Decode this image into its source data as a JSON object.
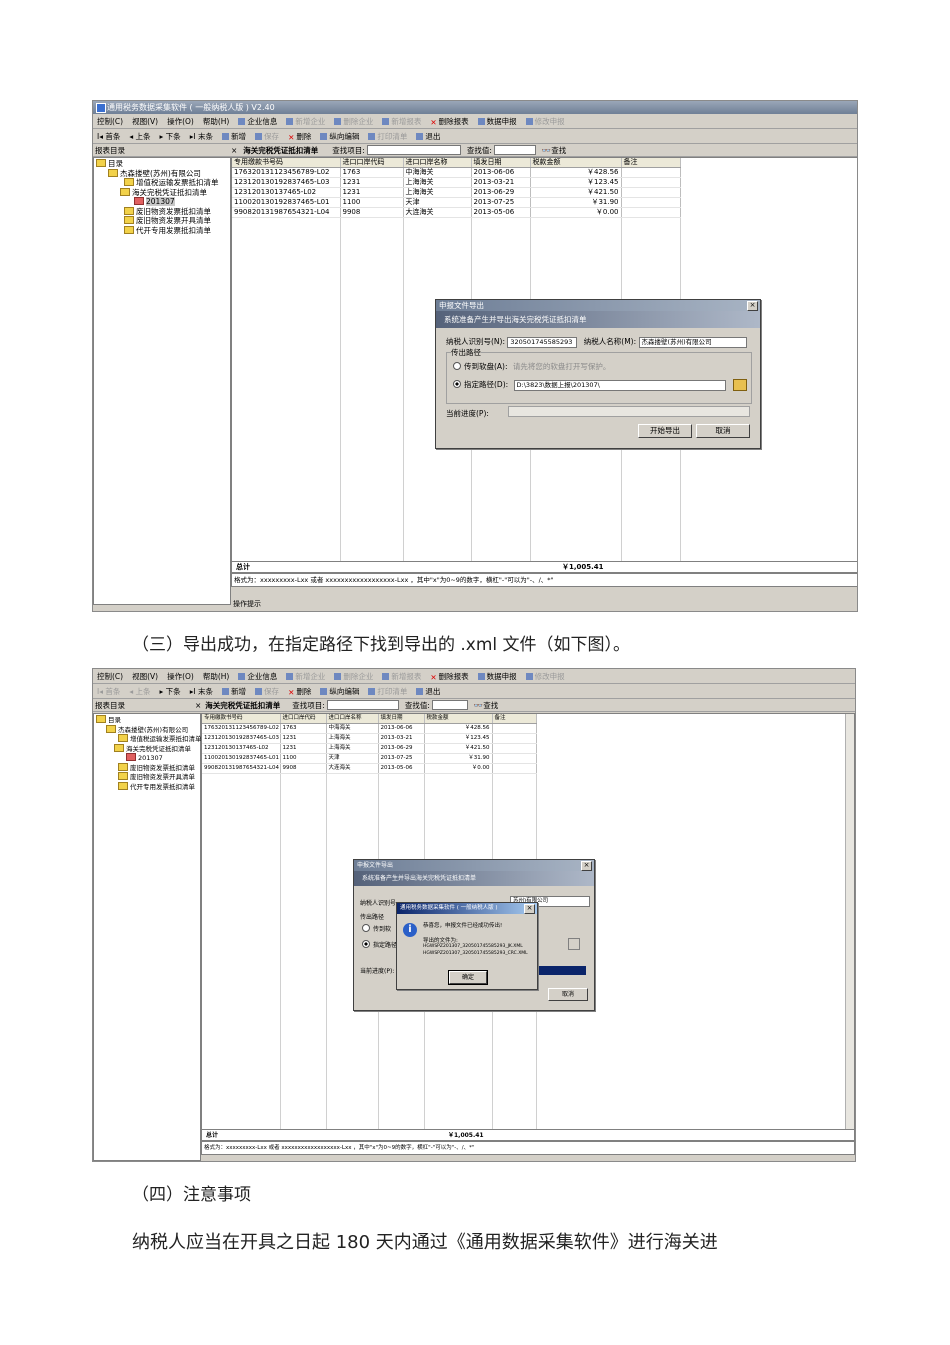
{
  "shot1": {
    "title": "通用税务数据采集软件 ( 一般纳税人版 ) V2.40",
    "menu": [
      "控制(C)",
      "视图(V)",
      "操作(O)",
      "帮助(H)"
    ],
    "toolbar": [
      "企业信息",
      "新增企业",
      "删除企业",
      "新增报表",
      "删除报表",
      "数据申报",
      "修改申报"
    ],
    "nav": [
      "I◂ 首条",
      "◂ 上条",
      "▸ 下条",
      "▸I 末条",
      "新增",
      "保存",
      "删除",
      "纵向编辑",
      "打印清单",
      "退出"
    ],
    "pane_label": "报表目录",
    "pane_close": "×",
    "grid_title": "海关完税凭证抵扣清单",
    "search_item_label": "查找项目:",
    "search_value_label": "查找值:",
    "search_button": "查找",
    "tree": [
      "目录",
      "杰森搂壁(苏州)有限公司",
      "增值税运输发票抵扣清单",
      "海关完税凭证抵扣清单",
      "201307",
      "废旧物资发票抵扣清单",
      "废旧物资发票开具清单",
      "代开专用发票抵扣清单"
    ],
    "columns": [
      "专用缴款书号码",
      "进口口岸代码",
      "进口口岸名称",
      "填发日期",
      "税款金额",
      "备注"
    ],
    "rows": [
      [
        "176320131123456789-L02",
        "1763",
        "中海海关",
        "2013-06-06",
        "￥428.56",
        ""
      ],
      [
        "123120130192837465-L03",
        "1231",
        "上海海关",
        "2013-03-21",
        "￥123.45",
        ""
      ],
      [
        "123120130137465-L02",
        "1231",
        "上海海关",
        "2013-06-29",
        "￥421.50",
        ""
      ],
      [
        "110020130192837465-L01",
        "1100",
        "天津",
        "2013-07-25",
        "￥31.90",
        ""
      ],
      [
        "990820131987654321-L04",
        "9908",
        "大连海关",
        "2013-05-06",
        "￥0.00",
        ""
      ]
    ],
    "total_label": "总计",
    "total_value": "￥1,005.41",
    "format_text": "格式为：xxxxxxxxx-Lxx 或者 xxxxxxxxxxxxxxxxxx-Lxx ，其中\"x\"为0~9的数字，横杠\"-\"可以为\"-、/、*\"",
    "status_label": "操作提示",
    "dialog": {
      "title": "申报文件导出",
      "banner": "系统准备产生并导出海关完税凭证抵扣清单",
      "taxid_label": "纳税人识别号(N):",
      "taxid_value": "320501745585293",
      "name_label": "纳税人名称(M):",
      "name_value": "杰森搂壁(苏州)有限公司",
      "group_label": "传出路径",
      "opt_disk": "传到软盘(A):",
      "opt_disk_hint": "请先将您的软盘打开写保护。",
      "opt_path": "指定路径(D):",
      "path_value": "D:\\3823\\数据上报\\201307\\",
      "progress_label": "当前进度(P):",
      "start_button": "开始导出",
      "cancel_button": "取消"
    }
  },
  "caption3": "（三）导出成功，在指定路径下找到导出的    .xml  文件（如下图）。",
  "shot2": {
    "menu": [
      "控制(C)",
      "视图(V)",
      "操作(O)",
      "帮助(H)"
    ],
    "toolbar": [
      "企业信息",
      "新增企业",
      "删除企业",
      "新增报表",
      "删除报表",
      "数据申报",
      "修改申报"
    ],
    "nav": [
      "I◂ 首条",
      "◂ 上条",
      "▸ 下条",
      "▸I 末条",
      "新增",
      "保存",
      "删除",
      "纵向编辑",
      "打印清单",
      "退出"
    ],
    "pane_label": "报表目录",
    "pane_close": "×",
    "grid_title": "海关完税凭证抵扣清单",
    "search_item_label": "查找项目:",
    "search_value_label": "查找值:",
    "search_button": "查找",
    "tree": [
      "目录",
      "杰森搂壁(苏州)有限公司",
      "增值税运输发票抵扣清单",
      "海关完税凭证抵扣清单",
      "201307",
      "废旧物资发票抵扣清单",
      "废旧物资发票开具清单",
      "代开专用发票抵扣清单"
    ],
    "columns": [
      "专用缴款书号码",
      "进口口岸代码",
      "进口口岸名称",
      "填发日期",
      "税款金额",
      "备注"
    ],
    "rows": [
      [
        "176320131123456789-L02",
        "1763",
        "中海海关",
        "2013-06-06",
        "￥428.56",
        ""
      ],
      [
        "123120130192837465-L03",
        "1231",
        "上海海关",
        "2013-03-21",
        "￥123.45",
        ""
      ],
      [
        "123120130137465-L02",
        "1231",
        "上海海关",
        "2013-06-29",
        "￥421.50",
        ""
      ],
      [
        "110020130192837465-L01",
        "1100",
        "天津",
        "2013-07-25",
        "￥31.90",
        ""
      ],
      [
        "990820131987654321-L04",
        "9908",
        "大连海关",
        "2013-05-06",
        "￥0.00",
        ""
      ]
    ],
    "total_label": "总计",
    "total_value": "￥1,005.41",
    "format_text": "格式为：xxxxxxxxx-Lxx 或者 xxxxxxxxxxxxxxxxxx-Lxx ，其中\"x\"为0~9的数字，横杠\"-\"可以为\"-、/、*\"",
    "dialog": {
      "title": "申报文件导出",
      "banner": "系统准备产生并导出海关完税凭证抵扣清单",
      "taxid_label": "纳税人识别号",
      "name_value_partial": "苏州)有限公司",
      "group_label": "传出路径",
      "opt_disk": "传到软",
      "opt_path": "指定路径",
      "progress_label": "当前进度(P):",
      "cancel_button": "取消"
    },
    "msgbox": {
      "title": "通用税务数据采集软件 ( 一般纳税人版 )",
      "line1": "恭喜您，申报文件已经成功传出!",
      "line2": "导出的文件为:",
      "file1": "HGWSPZ201307_320501745585293_JK.XML",
      "file2": "HGWSPZ201307_320501745585293_CRC.XML",
      "ok_button": "确定"
    }
  },
  "caption4": "（四）注意事项",
  "para": "纳税人应当在开具之日起    180  天内通过《通用数据采集软件》进行海关进"
}
